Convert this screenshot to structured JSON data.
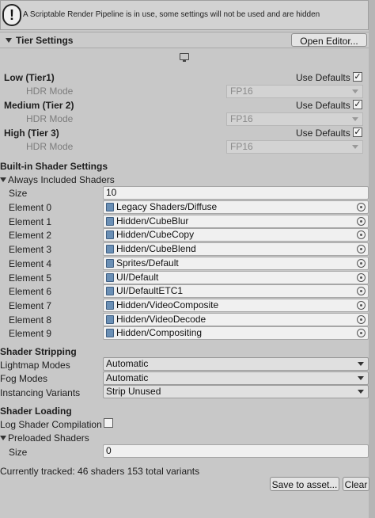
{
  "warning": {
    "icon": "!",
    "text": "A Scriptable Render Pipeline is in use, some settings will not be used and are hidden"
  },
  "tier_settings": {
    "title": "Tier Settings",
    "open_editor_label": "Open Editor...",
    "tiers": [
      {
        "label": "Low (Tier1)",
        "use_defaults_label": "Use Defaults",
        "use_defaults_checked": true,
        "hdr_mode_label": "HDR Mode",
        "hdr_mode_value": "FP16"
      },
      {
        "label": "Medium (Tier 2)",
        "use_defaults_label": "Use Defaults",
        "use_defaults_checked": true,
        "hdr_mode_label": "HDR Mode",
        "hdr_mode_value": "FP16"
      },
      {
        "label": "High (Tier 3)",
        "use_defaults_label": "Use Defaults",
        "use_defaults_checked": true,
        "hdr_mode_label": "HDR Mode",
        "hdr_mode_value": "FP16"
      }
    ]
  },
  "builtin_shaders": {
    "title": "Built-in Shader Settings",
    "always_included": {
      "label": "Always Included Shaders",
      "size_label": "Size",
      "size_value": "10",
      "elements": [
        {
          "label": "Element 0",
          "value": "Legacy Shaders/Diffuse"
        },
        {
          "label": "Element 1",
          "value": "Hidden/CubeBlur"
        },
        {
          "label": "Element 2",
          "value": "Hidden/CubeCopy"
        },
        {
          "label": "Element 3",
          "value": "Hidden/CubeBlend"
        },
        {
          "label": "Element 4",
          "value": "Sprites/Default"
        },
        {
          "label": "Element 5",
          "value": "UI/Default"
        },
        {
          "label": "Element 6",
          "value": "UI/DefaultETC1"
        },
        {
          "label": "Element 7",
          "value": "Hidden/VideoComposite"
        },
        {
          "label": "Element 8",
          "value": "Hidden/VideoDecode"
        },
        {
          "label": "Element 9",
          "value": "Hidden/Compositing"
        }
      ]
    }
  },
  "shader_stripping": {
    "title": "Shader Stripping",
    "rows": [
      {
        "label": "Lightmap Modes",
        "value": "Automatic"
      },
      {
        "label": "Fog Modes",
        "value": "Automatic"
      },
      {
        "label": "Instancing Variants",
        "value": "Strip Unused"
      }
    ]
  },
  "shader_loading": {
    "title": "Shader Loading",
    "log_label": "Log Shader Compilation",
    "log_checked": false,
    "preloaded_label": "Preloaded Shaders",
    "size_label": "Size",
    "size_value": "0"
  },
  "tracked_text": "Currently tracked: 46 shaders 153 total variants",
  "buttons": {
    "save_to_asset": "Save to asset...",
    "clear": "Clear"
  }
}
